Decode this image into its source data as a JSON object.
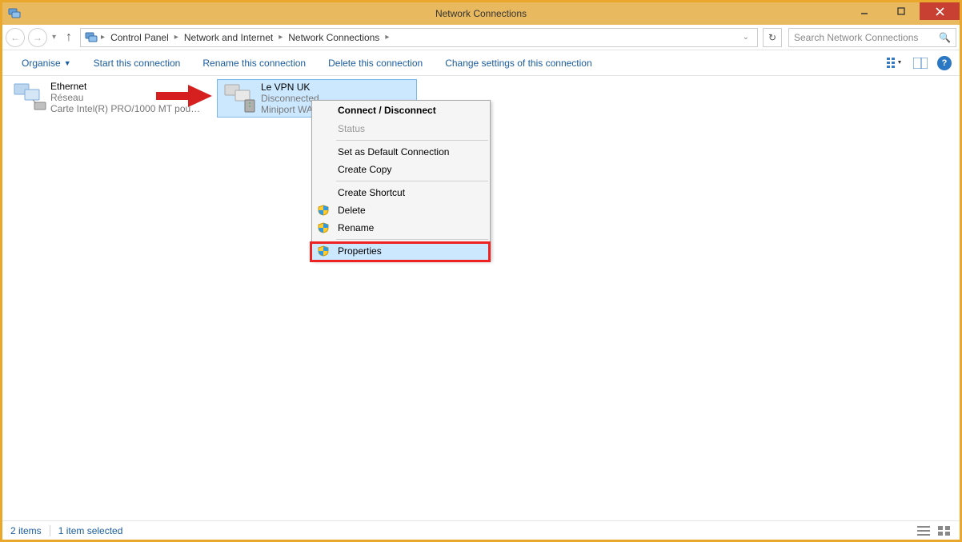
{
  "window": {
    "title": "Network Connections"
  },
  "breadcrumb": {
    "items": [
      "Control Panel",
      "Network and Internet",
      "Network Connections"
    ]
  },
  "search": {
    "placeholder": "Search Network Connections"
  },
  "toolbar": {
    "organise": "Organise",
    "start": "Start this connection",
    "rename": "Rename this connection",
    "delete": "Delete this connection",
    "change": "Change settings of this connection"
  },
  "connections": [
    {
      "name": "Ethernet",
      "line2": "Réseau",
      "line3": "Carte Intel(R) PRO/1000 MT pour ...",
      "selected": false
    },
    {
      "name": "Le VPN UK",
      "line2": "Disconnected",
      "line3": "Miniport WAN",
      "selected": true
    }
  ],
  "context_menu": {
    "header": "Connect / Disconnect",
    "items": [
      {
        "label": "Status",
        "enabled": false,
        "shield": false
      },
      {
        "divider": true
      },
      {
        "label": "Set as Default Connection",
        "enabled": true,
        "shield": false
      },
      {
        "label": "Create Copy",
        "enabled": true,
        "shield": false
      },
      {
        "divider": true
      },
      {
        "label": "Create Shortcut",
        "enabled": true,
        "shield": false
      },
      {
        "label": "Delete",
        "enabled": true,
        "shield": true
      },
      {
        "label": "Rename",
        "enabled": true,
        "shield": true
      },
      {
        "divider": true
      },
      {
        "label": "Properties",
        "enabled": true,
        "shield": true,
        "highlighted": true
      }
    ]
  },
  "statusbar": {
    "count": "2 items",
    "selected": "1 item selected"
  }
}
